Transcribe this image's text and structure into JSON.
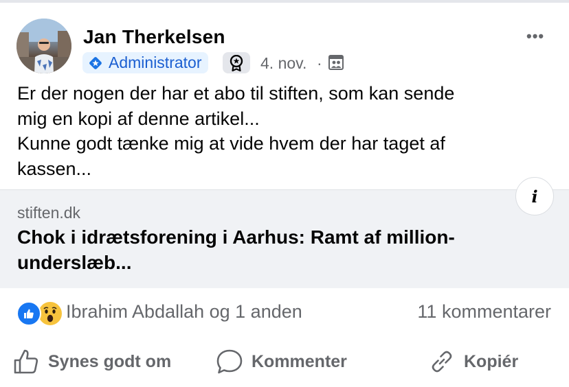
{
  "post": {
    "author": "Jan Therkelsen",
    "role_badge": "Administrator",
    "date": "4. nov.",
    "separator": "·",
    "audience_icon": "group-audience-icon",
    "award_icon": "award-badge-icon",
    "more_label": "•••",
    "body_lines": [
      "Er der nogen der har et abo til stiften, som kan sende",
      "mig en kopi af denne artikel...",
      "Kunne godt tænke mig at vide hvem der har taget af",
      "kassen..."
    ]
  },
  "link_preview": {
    "domain": "stiften.dk",
    "title": "Chok i idrætsforening i Aarhus: Ramt af million-underslæb...",
    "info_label": "i"
  },
  "engagement": {
    "reaction_types": [
      "like",
      "wow"
    ],
    "reactors_text": "Ibrahim Abdallah og 1 anden",
    "comments_text": "11 kommentarer"
  },
  "actions": {
    "like": "Synes godt om",
    "comment": "Kommenter",
    "copy": "Kopiér"
  },
  "colors": {
    "accent": "#1877f2",
    "badge_bg": "#e7f3ff",
    "secondary_text": "#65676b",
    "link_card_bg": "#f0f2f5",
    "wow_yellow": "#f7c33d"
  }
}
